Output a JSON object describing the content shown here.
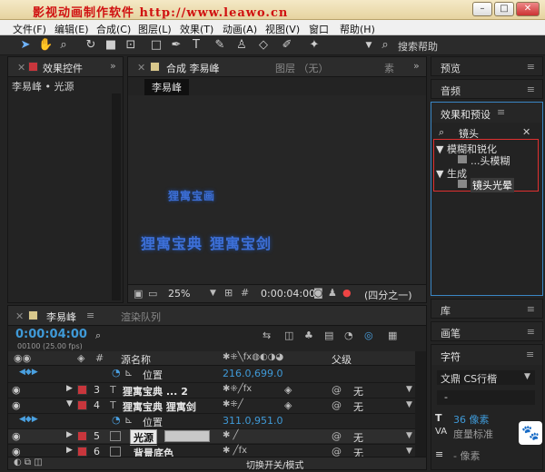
{
  "watermark": "影视动画制作软件  http://www.leawo.cn",
  "menu": [
    "文件(F)",
    "编辑(E)",
    "合成(C)",
    "图层(L)",
    "效果(T)",
    "动画(A)",
    "视图(V)",
    "窗口",
    "帮助(H)"
  ],
  "toolbar": {
    "search_help": "搜索帮助"
  },
  "effect_controls": {
    "tab": "效果控件",
    "layer_path": "李易峰 • 光源"
  },
  "composition": {
    "tab": "合成 李易峰",
    "tab_layer": "图层 （无）",
    "tab_extra": "素",
    "sub_tab": "李易峰",
    "zoom": "25%",
    "timecode": "0:00:04:00",
    "view": "(四分之一)",
    "canvas_texts": [
      "狸寓宝画",
      "狸寓宝典",
      "狸寓宝剑"
    ]
  },
  "right_panels": {
    "preview": "预览",
    "audio": "音频",
    "effects_presets": "效果和预设",
    "search_value": "镜头",
    "tree": [
      {
        "label": "模糊和锐化",
        "items": [
          "...头模糊"
        ]
      },
      {
        "label": "生成",
        "items": [
          "镜头光晕"
        ]
      }
    ],
    "library": "库",
    "brush": "画笔",
    "character": "字符",
    "font": "文鼎 CS行楷",
    "font_style": "-",
    "font_size": "36 像素",
    "metric": "度量标准",
    "dash_px": "- 像素"
  },
  "timeline": {
    "tab": "李易峰",
    "render_queue": "渲染队列",
    "timecode": "0:00:04:00",
    "frames": "00100 (25.00 fps)",
    "col_source": "源名称",
    "col_parent": "父级",
    "toggle_label": "切换开关/模式",
    "rows": [
      {
        "type": "prop",
        "label": "位置",
        "value": "216.0,699.0"
      },
      {
        "type": "layer",
        "num": "3",
        "name": "狸寓宝典 ... 2",
        "parent": "无"
      },
      {
        "type": "layer",
        "num": "4",
        "name": "狸寓宝典  狸寓剑",
        "parent": "无"
      },
      {
        "type": "prop",
        "label": "位置",
        "value": "311.0,951.0"
      },
      {
        "type": "layer",
        "num": "5",
        "name": "光源",
        "parent": "无"
      },
      {
        "type": "layer",
        "num": "6",
        "name": "背景底色",
        "parent": "无"
      }
    ]
  }
}
